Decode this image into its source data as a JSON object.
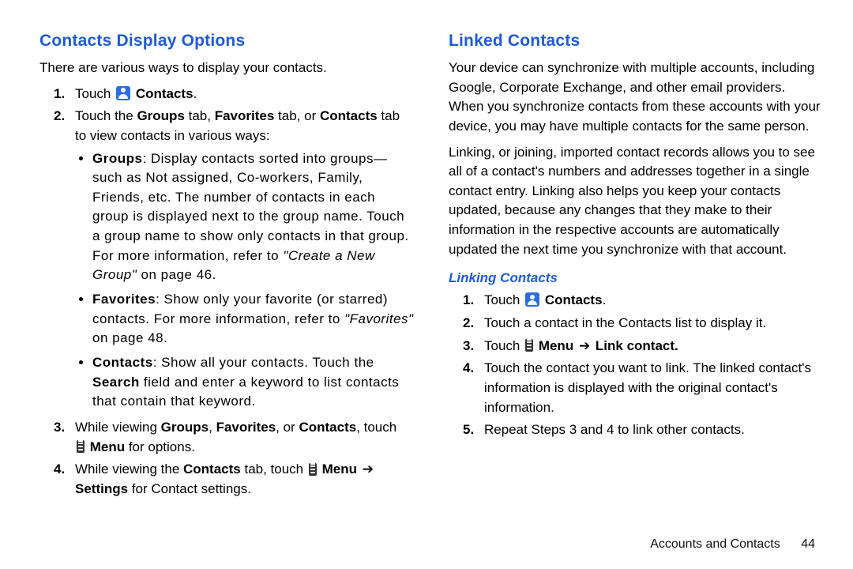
{
  "left": {
    "heading": "Contacts Display Options",
    "intro": "There are various ways to display your contacts.",
    "step1_a": "Touch ",
    "step1_b": " Contacts",
    "step1_c": ".",
    "step2_a": "Touch the ",
    "step2_groups": "Groups",
    "step2_b": " tab, ",
    "step2_fav": "Favorites",
    "step2_c": " tab, or ",
    "step2_cont": "Contacts",
    "step2_d": " tab to view contacts in various ways:",
    "bul_groups_lead": "Groups",
    "bul_groups_l1": ": Display contacts sorted into groups—such",
    "bul_groups_l2": "as Not assigned, Co-workers, Family, Friends, etc.",
    "bul_groups_l3": "The number of contacts in each group is displayed next to the group name.",
    "bul_groups_l4": "Touch a group name to show only contacts in that group.",
    "bul_groups_more_a": "For more information, refer to ",
    "bul_groups_more_i": "\"Create a New Group\"",
    "bul_groups_more_b": " on page 46.",
    "bul_fav_lead": "Favorites",
    "bul_fav_l1": ": Show only your favorite (or starred) contacts.",
    "bul_fav_more_a": "For more information, refer to ",
    "bul_fav_more_i": "\"Favorites\"",
    "bul_fav_more_b": " on page 48.",
    "bul_cont_lead": "Contacts",
    "bul_cont_l1": ": Show all your contacts. Touch the ",
    "bul_cont_search": "Search",
    "bul_cont_l2": " field and enter a keyword to list contacts that contain that keyword.",
    "step3_a": "While viewing ",
    "step3_b": ", ",
    "step3_c": ", or ",
    "step3_d": ", touch ",
    "step3_menu": " Menu",
    "step3_e": " for options.",
    "step4_a": "While viewing the ",
    "step4_b": " tab, touch ",
    "step4_menu": " Menu ",
    "step4_arrow": "➔",
    "step4_settings": " Settings",
    "step4_c": " for Contact settings."
  },
  "right": {
    "heading": "Linked Contacts",
    "p1": "Your device can synchronize with multiple accounts, including Google, Corporate Exchange, and other email providers. When you synchronize contacts from these accounts with your device, you may have multiple contacts for the same person.",
    "p2": "Linking, or joining, imported contact records allows you to see all of a contact's numbers and addresses together in a single contact entry. Linking also helps you keep your contacts updated, because any changes that they make to their information in the respective accounts are automatically updated the next time you synchronize with that account.",
    "sub": "Linking Contacts",
    "r1_a": "Touch ",
    "r1_b": " Contacts",
    "r1_c": ".",
    "r2_a": "Touch a contact in the ",
    "r2_b": "Contacts list",
    "r2_c": " to display it.",
    "r3_a": "Touch ",
    "r3_menu": " Menu ",
    "r3_arrow": "➔",
    "r3_link": " Link contact.",
    "r4": "Touch the contact you want to link. The linked contact's information is displayed with the original contact's information.",
    "r5": "Repeat Steps 3 and 4 to link other contacts."
  },
  "footer": {
    "section": "Accounts and Contacts",
    "page": "44"
  }
}
